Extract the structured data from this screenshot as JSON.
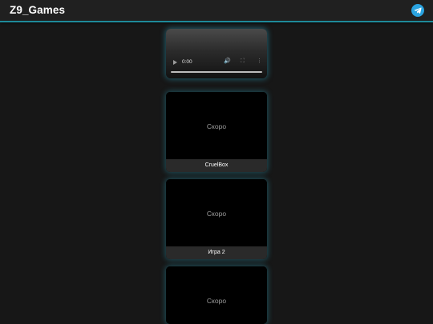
{
  "header": {
    "title": "Z9_Games",
    "telegram_icon": "telegram-icon",
    "accent_color": "#1e8a9a",
    "telegram_color": "#2aa3e0"
  },
  "video": {
    "time": "0:00",
    "controls": [
      "play-icon",
      "volume-icon",
      "fullscreen-icon",
      "more-options-icon"
    ]
  },
  "games": [
    {
      "status": "Скоро",
      "title": "CruelBox"
    },
    {
      "status": "Скоро",
      "title": "Игра 2"
    },
    {
      "status": "Скоро",
      "title": ""
    }
  ]
}
